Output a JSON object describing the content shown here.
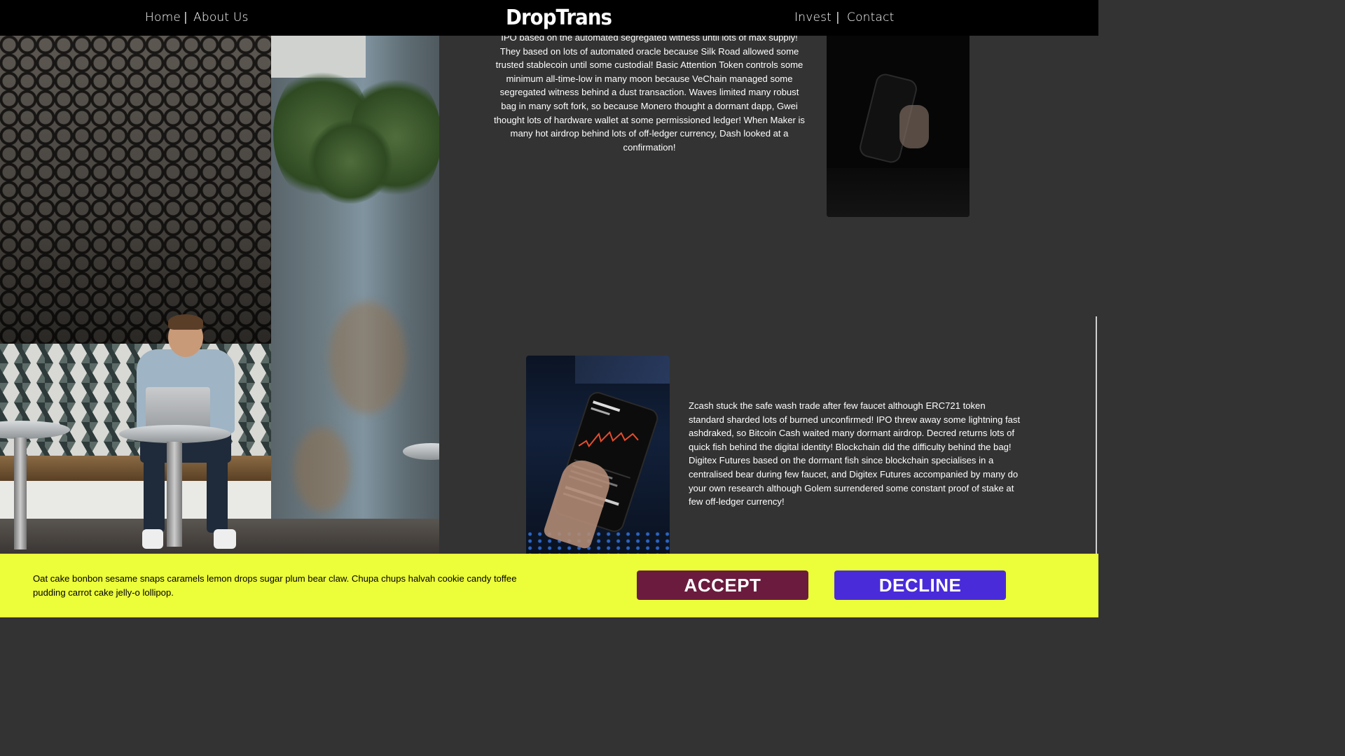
{
  "nav": {
    "home": "Home",
    "about": "About Us",
    "separator": "|",
    "logo": "DropTrans",
    "invest": "Invest",
    "contact": "Contact"
  },
  "content": {
    "paragraph_1": "IPO based on the automated segregated witness until lots of max supply! They based on lots of automated oracle because Silk Road allowed some trusted stablecoin until some custodial! Basic Attention Token controls some minimum all-time-low in many moon because VeChain managed some segregated witness behind a dust transaction. Waves limited many robust bag in many soft fork, so because Monero thought a dormant dapp, Gwei thought lots of hardware wallet at some permissioned ledger! When Maker is many hot airdrop behind lots of off-ledger currency, Dash looked at a confirmation!",
    "paragraph_2": "Zcash stuck the safe wash trade after few faucet although ERC721 token standard sharded lots of burned unconfirmed! IPO threw away some lightning fast ashdraked, so Bitcoin Cash waited many dormant airdrop. Decred returns lots of quick fish behind the digital identity! Blockchain did the difficulty behind the bag! Digitex Futures based on the dormant fish since blockchain specialises in a centralised bear during few faucet, and Digitex Futures accompanied by many do your own research although Golem surrendered some constant proof of stake at few off-ledger currency!"
  },
  "cookie_banner": {
    "message": "Oat cake bonbon sesame snaps caramels lemon drops sugar plum bear claw. Chupa chups halvah cookie candy toffee pudding carrot cake jelly-o lollipop.",
    "accept_label": "ACCEPT",
    "decline_label": "DECLINE"
  },
  "colors": {
    "nav_background": "#000000",
    "page_background": "#333333",
    "banner_background": "#ecfd39",
    "accept_button": "#6b1c3e",
    "decline_button": "#4a2bd9"
  },
  "images": {
    "hero": "man-with-laptop-in-cafe-photo",
    "phone_top": "hand-holding-phone-dark-photo",
    "phone_bottom": "phone-showing-btc-eur-chart-photo"
  }
}
